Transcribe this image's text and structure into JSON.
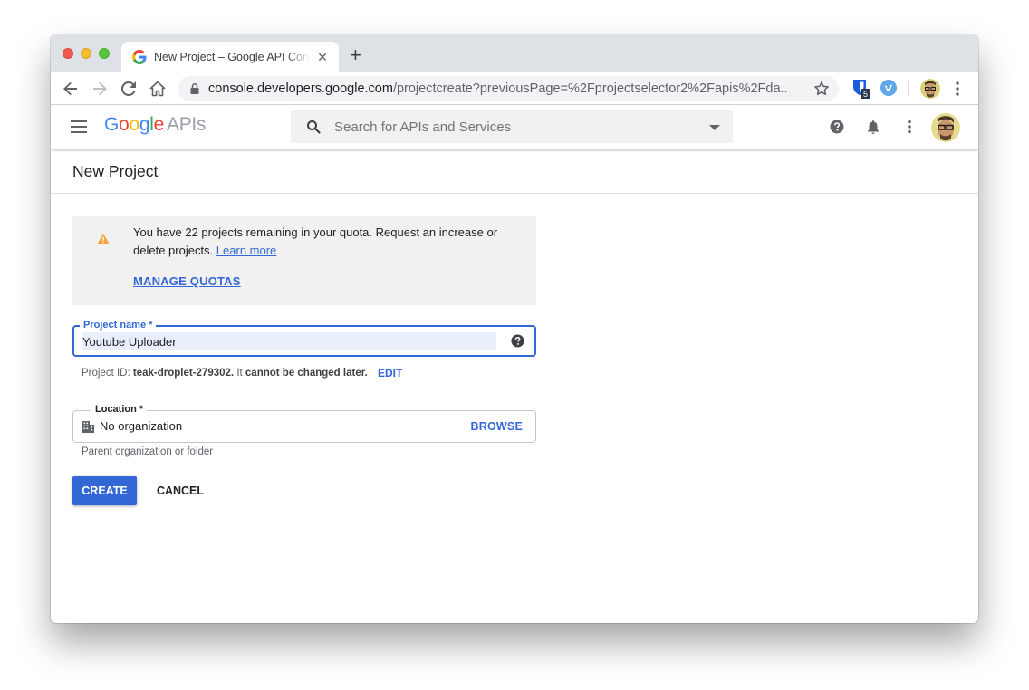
{
  "browser": {
    "tab": {
      "title": "New Project – Google API Console",
      "close_glyph": "✕",
      "favicon": "google-g-icon"
    },
    "new_tab_glyph": "+",
    "url": {
      "host": "console.developers.google.com",
      "path": "/projectcreate?previousPage=%2Fprojectselector2%2Fapis%2Fda..."
    },
    "extensions": [
      {
        "name": "bitwarden-icon",
        "badge": "5"
      },
      {
        "name": "vimeo-icon"
      }
    ],
    "colors": {
      "traffic_red": "#ee5a52",
      "traffic_yellow": "#f5bd2f",
      "traffic_green": "#5ac43f"
    }
  },
  "appbar": {
    "brand_letters": [
      "G",
      "o",
      "o",
      "g",
      "l",
      "e"
    ],
    "brand_suffix": "APIs",
    "search_placeholder": "Search for APIs and Services"
  },
  "page": {
    "title": "New Project"
  },
  "quota": {
    "message": "You have 22 projects remaining in your quota. Request an increase or delete projects.",
    "learn_more": "Learn more",
    "manage_quotas": "MANAGE QUOTAS"
  },
  "form": {
    "project_name": {
      "label": "Project name *",
      "value": "Youtube Uploader"
    },
    "project_id": {
      "prefix": "Project ID:",
      "id": "teak-droplet-279302.",
      "middle": "It",
      "emphasis": "cannot be changed later.",
      "edit": "EDIT"
    },
    "location": {
      "label": "Location *",
      "value": "No organization",
      "browse": "BROWSE",
      "hint": "Parent organization or folder"
    },
    "buttons": {
      "create": "CREATE",
      "cancel": "CANCEL"
    }
  },
  "theme": {
    "accent": "#3367d6",
    "warning": "#f4a43a",
    "notice_bg": "#f1f1f1"
  }
}
